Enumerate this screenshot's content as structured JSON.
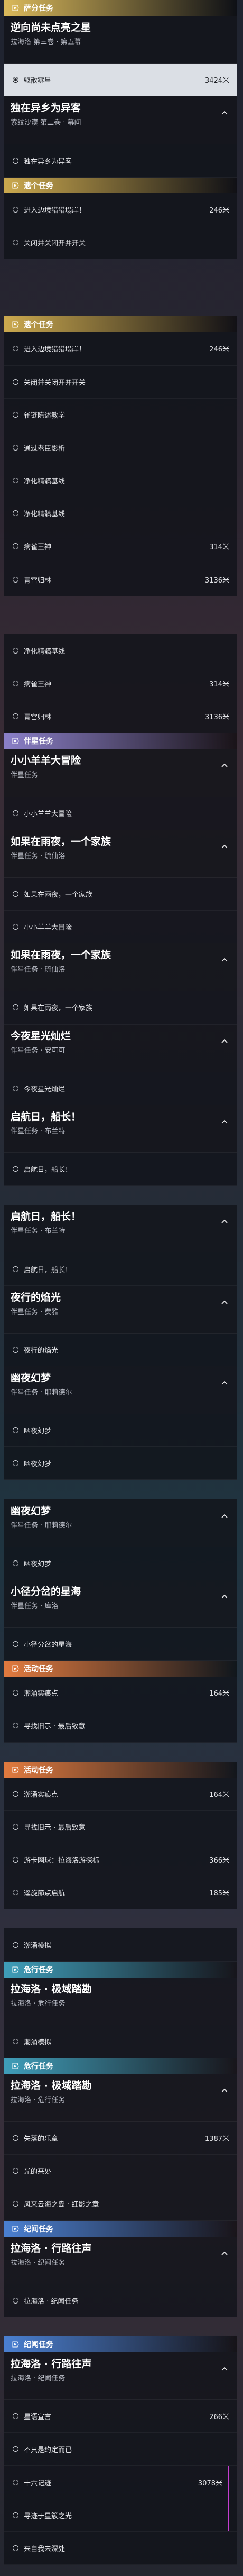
{
  "colors": {
    "main": "#d9b85a",
    "commission": "#caa84e",
    "companion": "#8a7fc7",
    "event": "#e07a3f",
    "danger": "#3f9db8",
    "memorial": "#4a7fd0",
    "selected_marker": "#c53dd0"
  },
  "icons": {
    "category": "quest-category-icon",
    "objective": "objective-circle-icon",
    "selected": "selected-objective-icon",
    "collapse": "chevron-up-icon"
  },
  "blocks": [
    {
      "type": "category",
      "id": "main1",
      "color": "#d9b85a",
      "label": "萨分任务"
    },
    {
      "type": "quest",
      "title": "逆向尚未点亮之星",
      "sub": "拉海洛 第三卷 · 第五幕",
      "chevron": false
    },
    {
      "type": "row",
      "label": "驱散雾星",
      "dist": "3424米",
      "selected": true
    },
    {
      "type": "quest",
      "title": "独在异乡为异客",
      "sub": "紫纹沙漠 第二卷 · 幕间",
      "chevron": true
    },
    {
      "type": "row",
      "label": "独在异乡为异客",
      "dist": ""
    },
    {
      "type": "category",
      "id": "c1",
      "color": "#caa84e",
      "label": "遗个任务"
    },
    {
      "type": "row",
      "label": "进入边境猎猎塕岸！",
      "dist": "246米"
    },
    {
      "type": "row",
      "label": "关闭并关闭开并开关",
      "dist": ""
    },
    {
      "type": "gap"
    },
    {
      "type": "gap"
    },
    {
      "type": "gap"
    },
    {
      "type": "category",
      "id": "c2",
      "color": "#caa84e",
      "label": "遗个任务"
    },
    {
      "type": "row",
      "label": "进入边境猎猎塕岸！",
      "dist": "246米"
    },
    {
      "type": "row",
      "label": "关闭并关闭开并开关",
      "dist": ""
    },
    {
      "type": "row",
      "label": "雀链陈述教学",
      "dist": ""
    },
    {
      "type": "row",
      "label": "通过老臣影析",
      "dist": ""
    },
    {
      "type": "row",
      "label": "净化精髇基线",
      "dist": ""
    },
    {
      "type": "row",
      "label": "净化精髇基线",
      "dist": ""
    },
    {
      "type": "row",
      "label": "病雀王神",
      "dist": "314米"
    },
    {
      "type": "row",
      "label": "青宫归林",
      "dist": "3136米"
    },
    {
      "type": "gap"
    },
    {
      "type": "gap"
    },
    {
      "type": "row",
      "label": "净化精髇基线",
      "dist": ""
    },
    {
      "type": "row",
      "label": "病雀王神",
      "dist": "314米"
    },
    {
      "type": "row",
      "label": "青宫归林",
      "dist": "3136米"
    },
    {
      "type": "category",
      "id": "comp1",
      "color": "#8a7fc7",
      "label": "伴星任务"
    },
    {
      "type": "quest",
      "title": "小小羊羊大冒险",
      "sub": "伴星任务",
      "chevron": true
    },
    {
      "type": "row",
      "label": "小小羊羊大冒险",
      "dist": ""
    },
    {
      "type": "quest",
      "title": "如果在雨夜，一个家族",
      "sub": "伴星任务 · 琉仙洛",
      "chevron": true
    },
    {
      "type": "row",
      "label": "如果在雨夜，一个家族",
      "dist": ""
    },
    {
      "type": "row",
      "label": "小小羊羊大冒险",
      "dist": ""
    },
    {
      "type": "quest",
      "title": "如果在雨夜，一个家族",
      "sub": "伴星任务 · 琉仙洛",
      "chevron": true
    },
    {
      "type": "row",
      "label": "如果在雨夜，一个家族",
      "dist": ""
    },
    {
      "type": "quest",
      "title": "今夜星光灿烂",
      "sub": "伴星任务 · 安可可",
      "chevron": true
    },
    {
      "type": "row",
      "label": "今夜星光灿烂",
      "dist": ""
    },
    {
      "type": "quest",
      "title": "启航日，船长！",
      "sub": "伴星任务 · 布兰特",
      "chevron": true
    },
    {
      "type": "row",
      "label": "启航日，船长！",
      "dist": ""
    },
    {
      "type": "gap"
    },
    {
      "type": "quest",
      "title": "启航日，船长！",
      "sub": "伴星任务 · 布兰特",
      "chevron": true
    },
    {
      "type": "row",
      "label": "启航日，船长！",
      "dist": ""
    },
    {
      "type": "quest",
      "title": "夜行的焰光",
      "sub": "伴星任务 · 费雅",
      "chevron": true
    },
    {
      "type": "row",
      "label": "夜行的焰光",
      "dist": ""
    },
    {
      "type": "quest",
      "title": "幽夜幻梦",
      "sub": "伴星任务 · 耶莉德尔",
      "chevron": true
    },
    {
      "type": "row",
      "label": "幽夜幻梦",
      "dist": ""
    },
    {
      "type": "row",
      "label": "幽夜幻梦",
      "dist": ""
    },
    {
      "type": "gap"
    },
    {
      "type": "quest",
      "title": "幽夜幻梦",
      "sub": "伴星任务 · 耶莉德尔",
      "chevron": true
    },
    {
      "type": "row",
      "label": "幽夜幻梦",
      "dist": ""
    },
    {
      "type": "quest",
      "title": "小径分岔的星海",
      "sub": "伴星任务 · 库洛",
      "chevron": true
    },
    {
      "type": "row",
      "label": "小径分岔的星海",
      "dist": ""
    },
    {
      "type": "category",
      "id": "ev1",
      "color": "#e07a3f",
      "label": "活动任务"
    },
    {
      "type": "row",
      "label": "潮涌实痕点",
      "dist": "164米"
    },
    {
      "type": "row",
      "label": "寻找旧示 · 最后致意",
      "dist": ""
    },
    {
      "type": "gap"
    },
    {
      "type": "category",
      "id": "ev2",
      "color": "#e07a3f",
      "label": "活动任务"
    },
    {
      "type": "row",
      "label": "潮涌实痕点",
      "dist": "164米"
    },
    {
      "type": "row",
      "label": "寻找旧示 · 最后致意",
      "dist": ""
    },
    {
      "type": "row",
      "label": "游卡网球：拉海洛游探标",
      "dist": "366米"
    },
    {
      "type": "row",
      "label": "逕旋節点启航",
      "dist": "185米"
    },
    {
      "type": "gap"
    },
    {
      "type": "row",
      "label": "潮涌模拟",
      "dist": ""
    },
    {
      "type": "category",
      "id": "d1",
      "color": "#3f9db8",
      "label": "危行任务"
    },
    {
      "type": "quest",
      "title": "拉海洛 · 极域踏勘",
      "sub": "拉海洛 · 危行任务",
      "chevron": false
    },
    {
      "type": "row",
      "label": "潮涌模拟",
      "dist": ""
    },
    {
      "type": "category",
      "id": "d2",
      "color": "#3f9db8",
      "label": "危行任务"
    },
    {
      "type": "quest",
      "title": "拉海洛 · 极域踏勘",
      "sub": "拉海洛 · 危行任务",
      "chevron": true
    },
    {
      "type": "row",
      "label": "失落的乐章",
      "dist": "1387米"
    },
    {
      "type": "row",
      "label": "光的来处",
      "dist": ""
    },
    {
      "type": "row",
      "label": "风来云海之岛 · 红影之章",
      "dist": ""
    },
    {
      "type": "category",
      "id": "m1",
      "color": "#4a7fd0",
      "label": "纪闻任务"
    },
    {
      "type": "quest",
      "title": "拉海洛 · 行路往声",
      "sub": "拉海洛 · 纪闻任务",
      "chevron": true
    },
    {
      "type": "row",
      "label": "拉海洛 · 纪闻任务",
      "dist": ""
    },
    {
      "type": "gap"
    },
    {
      "type": "category",
      "id": "m2",
      "color": "#4a7fd0",
      "label": "纪闻任务"
    },
    {
      "type": "quest",
      "title": "拉海洛 · 行路往声",
      "sub": "拉海洛 · 纪闻任务",
      "chevron": true
    },
    {
      "type": "row",
      "label": "星语宣言",
      "dist": "266米"
    },
    {
      "type": "row",
      "label": "不只是约定而已",
      "dist": ""
    },
    {
      "type": "row",
      "label": "十六记迹",
      "dist": "3078米",
      "marked": true
    },
    {
      "type": "row",
      "label": "寻迹于星簇之光",
      "dist": "",
      "marked": true
    },
    {
      "type": "row",
      "label": "来自我未深处",
      "dist": ""
    }
  ]
}
